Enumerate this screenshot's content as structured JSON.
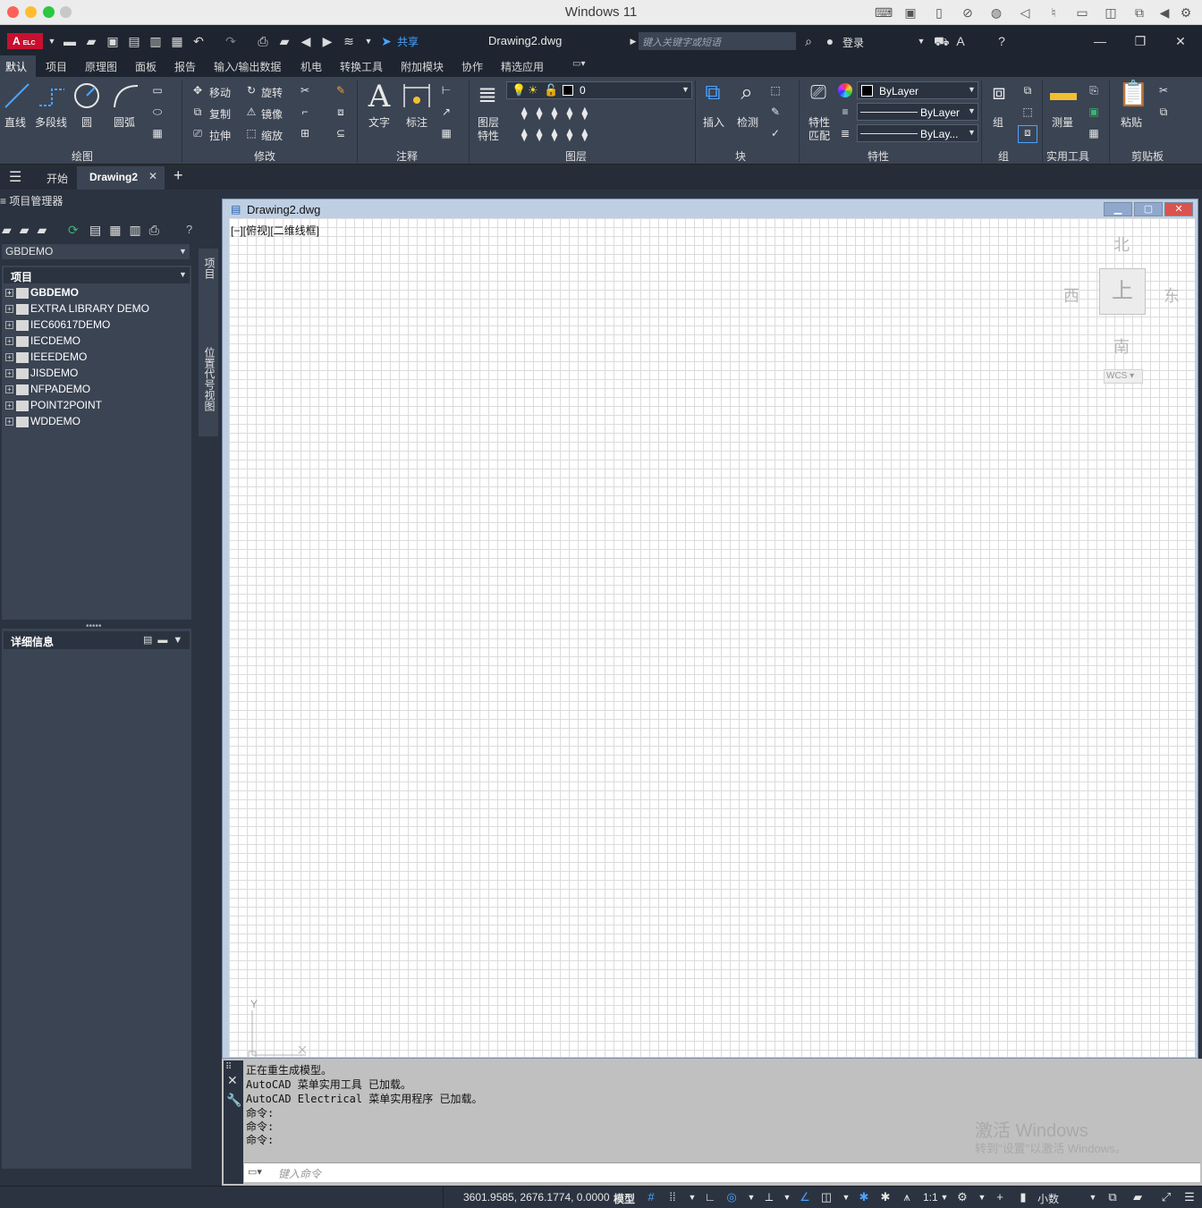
{
  "os": {
    "title": "Windows 11"
  },
  "app": {
    "logo_text": "A",
    "logo_sub": "ELC",
    "doc_title": "Drawing2.dwg",
    "share_label": "共享",
    "search_placeholder": "键入关键字或短语",
    "login_label": "登录"
  },
  "menu_tabs": [
    "默认",
    "项目",
    "原理图",
    "面板",
    "报告",
    "输入/输出数据",
    "机电",
    "转换工具",
    "附加模块",
    "协作",
    "精选应用"
  ],
  "ribbon": {
    "draw": {
      "title": "绘图",
      "line": "直线",
      "polyline": "多段线",
      "circle": "圆",
      "arc": "圆弧"
    },
    "modify": {
      "title": "修改",
      "move": "移动",
      "rotate": "旋转",
      "copy": "复制",
      "mirror": "镜像",
      "stretch": "拉伸",
      "scale": "缩放"
    },
    "annotation": {
      "title": "注释",
      "text": "文字",
      "dimension": "标注"
    },
    "layers": {
      "title": "图层",
      "layer_props": "图层",
      "layer_props2": "特性",
      "current_layer": "0"
    },
    "block": {
      "title": "块",
      "insert": "插入",
      "inspect": "检测"
    },
    "properties": {
      "title": "特性",
      "match": "特性",
      "match2": "匹配",
      "color": "ByLayer",
      "linetype": "ByLayer",
      "lineweight": "ByLay..."
    },
    "groups": {
      "title": "组",
      "group": "组"
    },
    "utilities": {
      "title": "实用工具",
      "measure": "测量"
    },
    "clipboard": {
      "title": "剪贴板",
      "paste": "粘贴"
    }
  },
  "doc_tabs": {
    "start": "开始",
    "drawing": "Drawing2"
  },
  "project_manager": {
    "header": "项目管理器",
    "selected_project": "GBDEMO",
    "tree_header": "项目",
    "projects": [
      "GBDEMO",
      "EXTRA LIBRARY DEMO",
      "IEC60617DEMO",
      "IECDEMO",
      "IEEEDEMO",
      "JISDEMO",
      "NFPADEMO",
      "POINT2POINT",
      "WDDEMO"
    ],
    "details_header": "详细信息",
    "side_tab_project": "项目",
    "side_tab_location": "位置代号视图"
  },
  "drawing_window": {
    "title": "Drawing2.dwg",
    "view_label": "[−][俯视][二维线框]",
    "viewcube": {
      "north": "北",
      "south": "南",
      "east": "东",
      "west": "西",
      "top": "上",
      "wcs": "WCS"
    },
    "ucs_y": "Y",
    "ucs_x": "X"
  },
  "command": {
    "history": [
      "正在重生成模型。",
      "AutoCAD 菜单实用工具 已加载。",
      "AutoCAD Electrical 菜单实用程序 已加载。",
      "命令:",
      "命令:",
      "命令:"
    ],
    "placeholder": "键入命令"
  },
  "watermark": {
    "line1": "激活 Windows",
    "line2": "转到\"设置\"以激活 Windows。"
  },
  "status": {
    "coords": "3601.9585, 2676.1774, 0.0000",
    "model": "模型",
    "scale": "1:1",
    "units": "小数"
  }
}
